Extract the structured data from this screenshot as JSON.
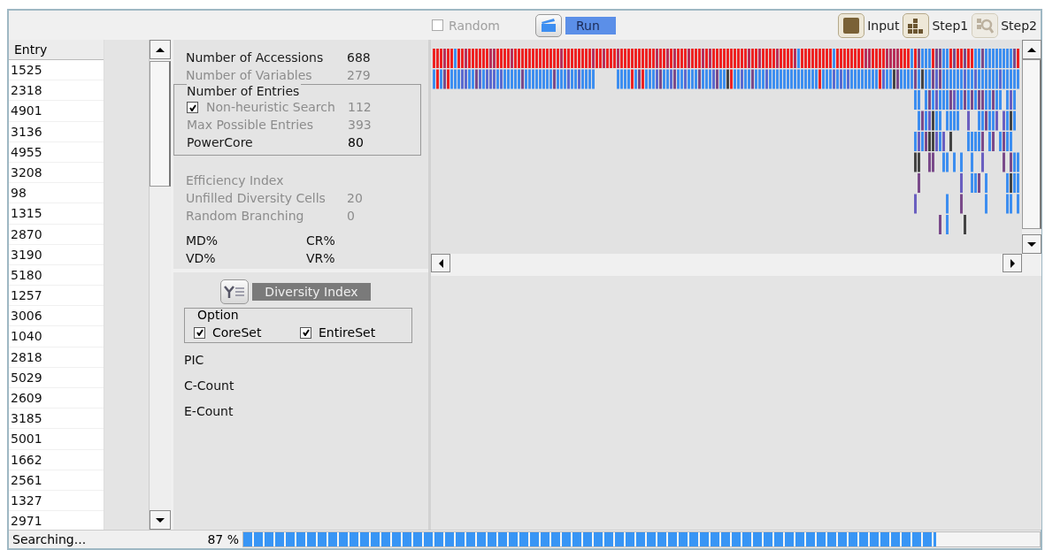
{
  "toolbar": {
    "random": {
      "label": "Random",
      "checked": false,
      "disabled": true
    },
    "run": {
      "label": "Run"
    },
    "buttons": [
      {
        "label": "Input",
        "disabled": false
      },
      {
        "label": "Step1",
        "disabled": false
      },
      {
        "label": "Step2",
        "disabled": true
      }
    ]
  },
  "entry_list": {
    "header": "Entry",
    "rows": [
      "1525",
      "2318",
      "4901",
      "3136",
      "4955",
      "3208",
      "98",
      "1315",
      "2870",
      "3190",
      "5180",
      "1257",
      "3006",
      "1040",
      "2818",
      "5029",
      "2609",
      "3185",
      "5001",
      "1662",
      "2561",
      "1327",
      "2971"
    ]
  },
  "summary": {
    "stats": [
      {
        "label": "Number of Accessions",
        "value": "688",
        "disabled": false
      },
      {
        "label": "Number of Variables",
        "value": "279",
        "disabled": true
      }
    ],
    "entries_group": {
      "title": "Number of Entries",
      "rows": [
        {
          "kind": "checkbox",
          "label": "Non-heuristic Search",
          "value": "112",
          "checked": true,
          "disabled": true
        },
        {
          "kind": "text",
          "label": "Max Possible Entries",
          "value": "393",
          "disabled": true
        },
        {
          "kind": "text",
          "label": "PowerCore",
          "value": "80",
          "disabled": false
        }
      ]
    },
    "efficiency": [
      {
        "label": "Efficiency Index",
        "disabled": true
      },
      {
        "label": "Unfilled Diversity Cells",
        "value": "20",
        "disabled": true
      },
      {
        "label": "Random Branching",
        "value": "0",
        "disabled": true
      }
    ],
    "percent_labels": [
      "MD%",
      "CR%",
      "VD%",
      "VR%"
    ]
  },
  "diversity": {
    "button": "Diversity Index",
    "option_group": {
      "title": "Option",
      "options": [
        {
          "label": "CoreSet",
          "checked": true
        },
        {
          "label": "EntireSet",
          "checked": true
        }
      ]
    },
    "metrics": [
      "PIC",
      "C-Count",
      "E-Count"
    ]
  },
  "status_bar": {
    "text": "Searching...",
    "progress": {
      "reading": "87 %",
      "level": 0.87
    }
  }
}
